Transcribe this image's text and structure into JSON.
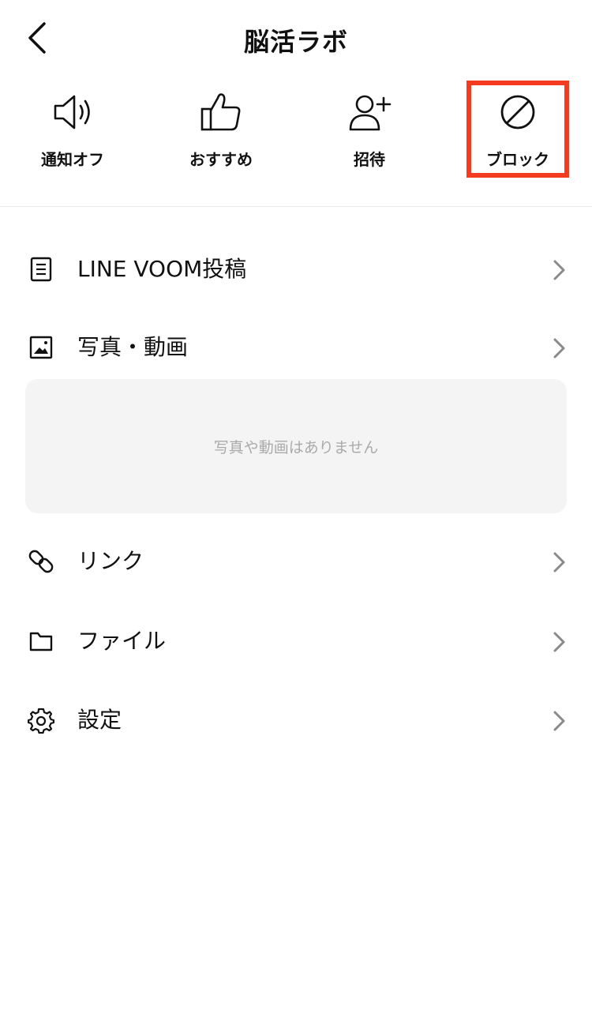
{
  "header": {
    "title": "脳活ラボ"
  },
  "actions": [
    {
      "label": "通知オフ",
      "icon": "speaker-icon"
    },
    {
      "label": "おすすめ",
      "icon": "thumbs-up-icon"
    },
    {
      "label": "招待",
      "icon": "add-person-icon"
    },
    {
      "label": "ブロック",
      "icon": "block-icon"
    }
  ],
  "highlight_color": "#f23b1f",
  "menu": {
    "voom": "LINE VOOM投稿",
    "media": "写真・動画",
    "media_empty": "写真や動画はありません",
    "link": "リンク",
    "file": "ファイル",
    "settings": "設定"
  }
}
